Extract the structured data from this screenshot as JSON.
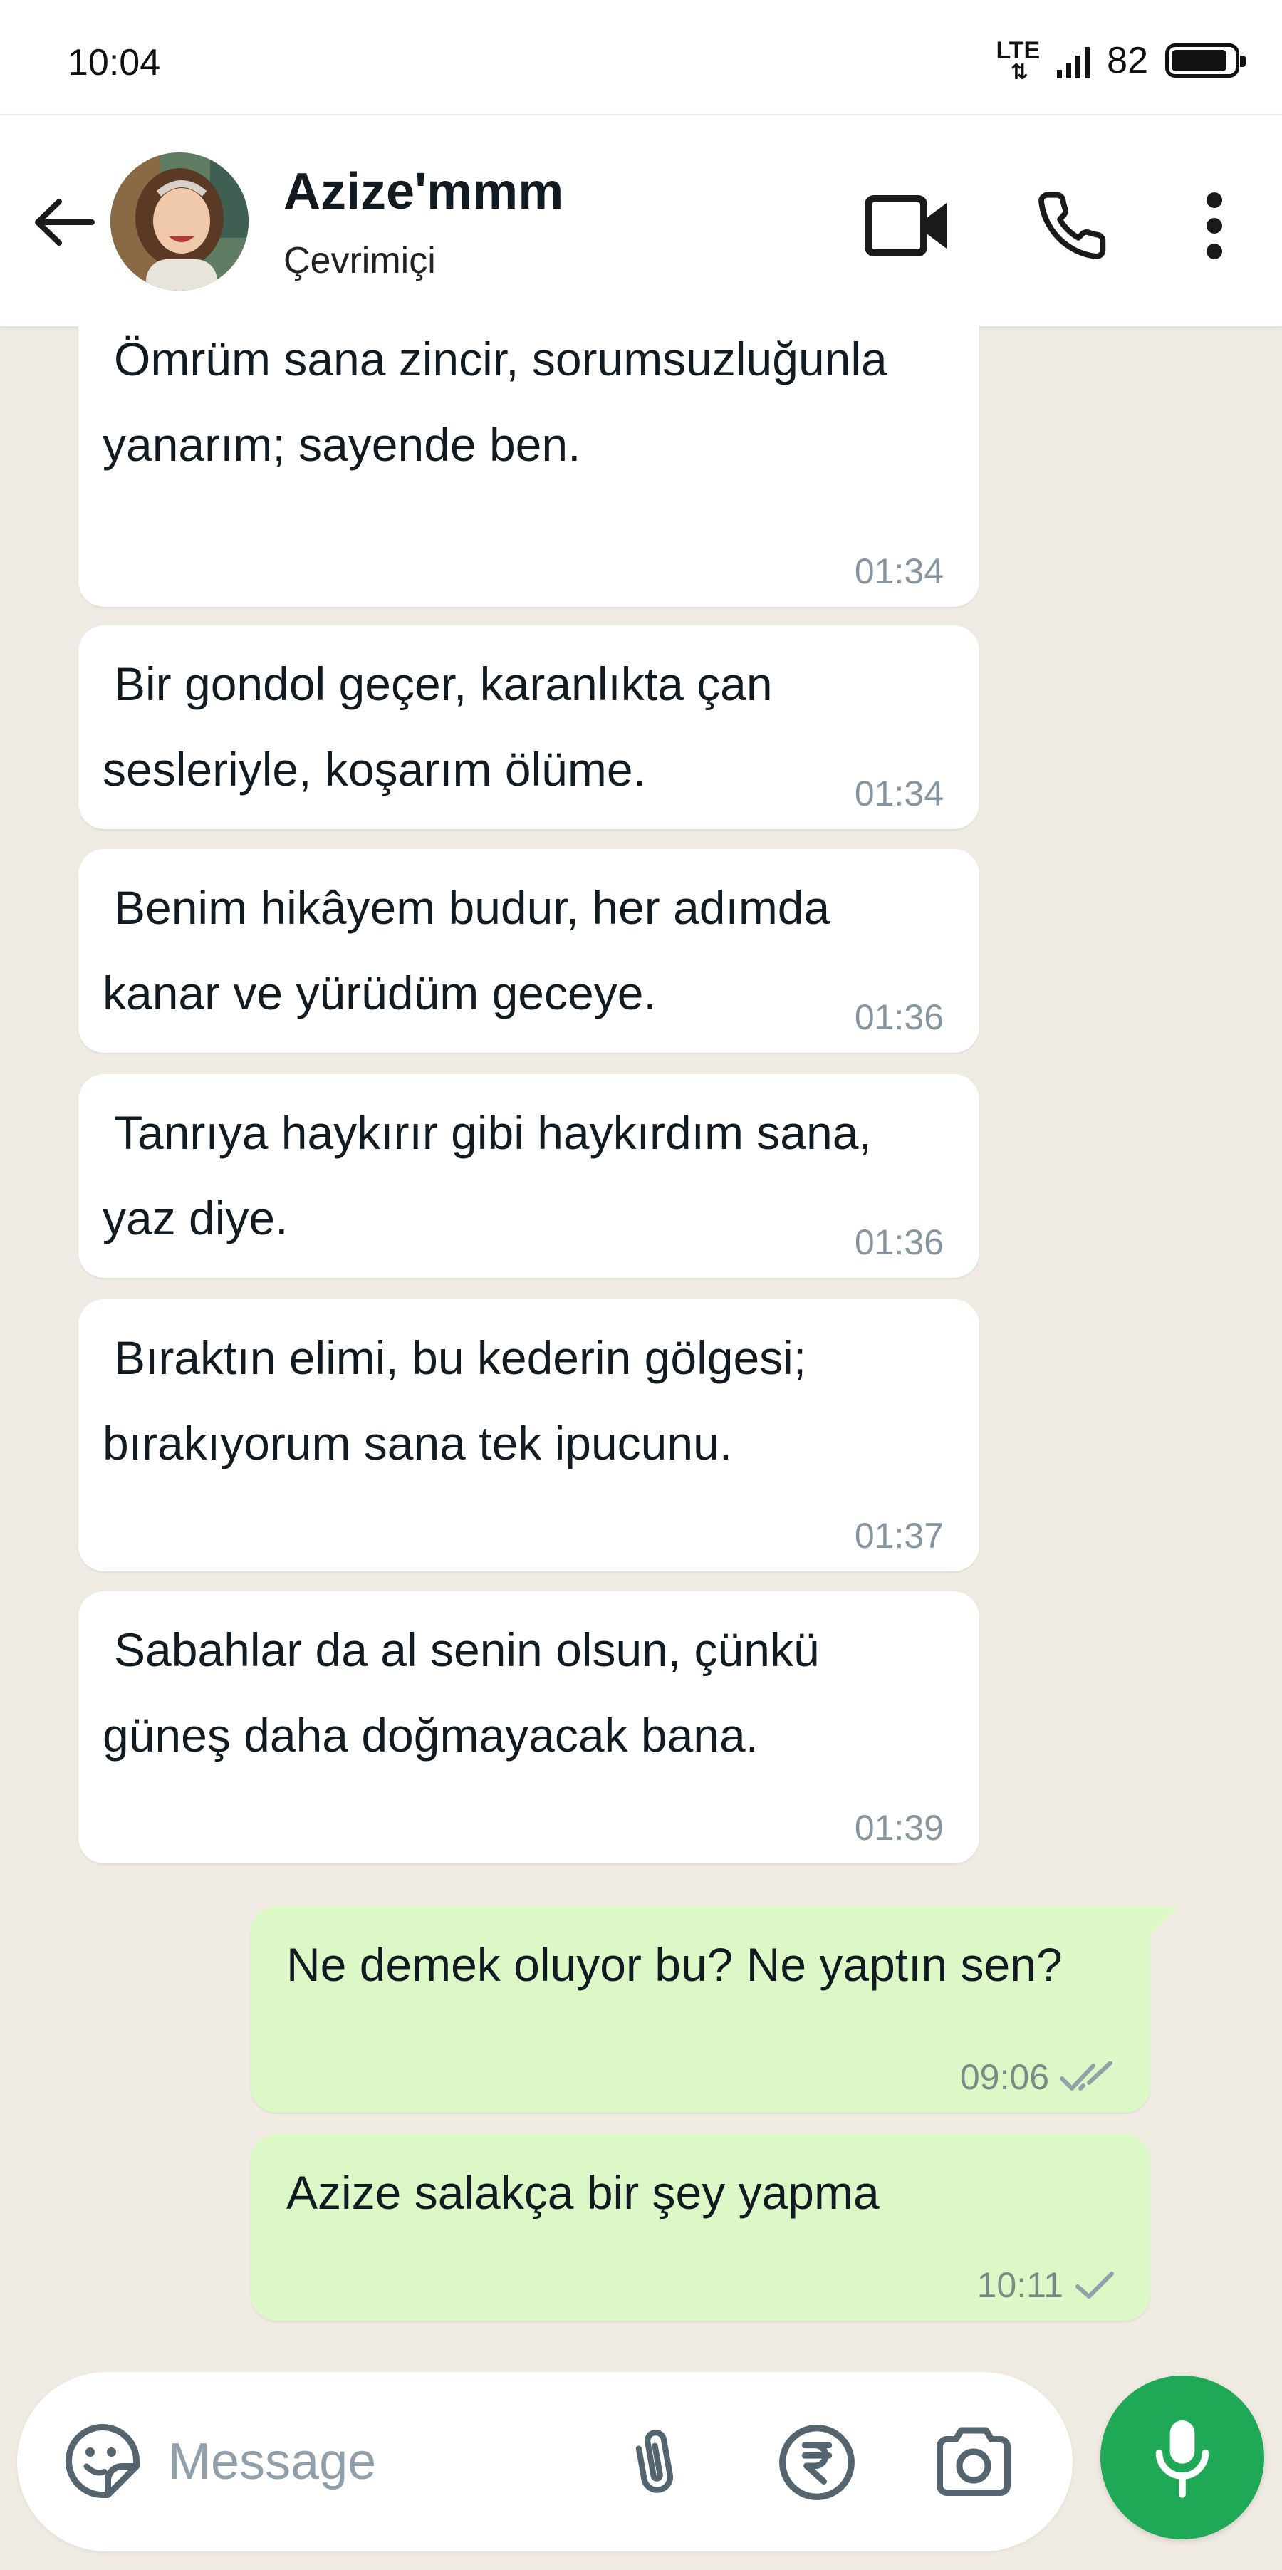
{
  "status_bar": {
    "time": "10:04",
    "network": "LTE",
    "network_arrows": "⇅",
    "battery": "82",
    "battery_level": 0.82
  },
  "header": {
    "contact_name": "Azize'mmm",
    "contact_status": "Çevrimiçi"
  },
  "messages": [
    {
      "direction": "in",
      "text": "Ömrüm sana zincir, sorumsuzluğunla yanarım; sayende ben.",
      "time": "01:34"
    },
    {
      "direction": "in",
      "text": "Bir gondol geçer, karanlıkta çan sesleriyle, koşarım ölüme.",
      "time": "01:34"
    },
    {
      "direction": "in",
      "text": "Benim hikâyem budur, her adımda kanar ve yürüdüm geceye.",
      "time": "01:36"
    },
    {
      "direction": "in",
      "text": "Tanrıya haykırır gibi haykırdım sana, yaz diye.",
      "time": "01:36"
    },
    {
      "direction": "in",
      "text": "Bıraktın elimi, bu kederin gölgesi; bırakıyorum sana tek ipucunu.",
      "time": "01:37"
    },
    {
      "direction": "in",
      "text": "Sabahlar da al senin olsun, çünkü güneş daha doğmayacak bana.",
      "time": "01:39"
    },
    {
      "direction": "out",
      "text": "Ne demek oluyor bu? Ne yaptın sen?",
      "time": "09:06",
      "status": "delivered"
    },
    {
      "direction": "out",
      "text": "Azize salakça bir şey yapma",
      "time": "10:11",
      "status": "sent"
    }
  ],
  "input": {
    "placeholder": "Message"
  },
  "colors": {
    "chat_background": "#efeae2",
    "incoming_bubble": "#ffffff",
    "outgoing_bubble": "#dcf8c6",
    "mic_button": "#1fa855",
    "timestamp": "#8696a0"
  },
  "icons": {
    "back": "arrow-left-icon",
    "video": "video-camera-icon",
    "call": "phone-icon",
    "menu": "more-vertical-icon",
    "sticker": "sticker-icon",
    "attach": "paperclip-icon",
    "payment": "rupee-icon",
    "camera": "camera-icon",
    "mic": "microphone-icon",
    "delivered": "double-check-icon",
    "sent": "single-check-icon"
  }
}
